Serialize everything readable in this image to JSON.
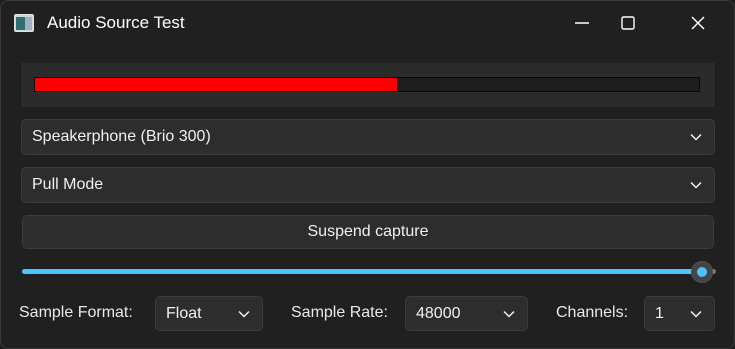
{
  "window": {
    "title": "Audio Source Test",
    "icon": "app-window-icon"
  },
  "titlebar_buttons": [
    "minimize-icon",
    "maximize-icon",
    "close-icon"
  ],
  "level_meter": {
    "level": 0.545,
    "color": "#ff0000"
  },
  "device_select": {
    "value": "Speakerphone (Brio 300)"
  },
  "mode_select": {
    "value": "Pull Mode"
  },
  "capture_button": {
    "label": "Suspend capture"
  },
  "volume_slider": {
    "value": 0.98,
    "accent": "#4cc2ff"
  },
  "format_row": {
    "sample_format_label": "Sample Format:",
    "sample_format_value": "Float",
    "sample_rate_label": "Sample Rate:",
    "sample_rate_value": "48000",
    "channels_label": "Channels:",
    "channels_value": "1"
  }
}
